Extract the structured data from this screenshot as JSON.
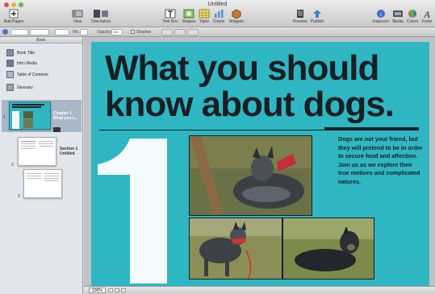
{
  "window": {
    "title": "Untitled"
  },
  "toolbar": {
    "add_pages": "Add Pages",
    "view": "View",
    "orientation": "Orientation",
    "text_box": "Text Box",
    "shapes": "Shapes",
    "table": "Table",
    "charts": "Charts",
    "widgets": "Widgets",
    "preview": "Preview",
    "publish": "Publish",
    "inspector": "Inspector",
    "media": "Media",
    "colors": "Colors",
    "fonts": "Fonts"
  },
  "formatbar": {
    "fill_label": "Fill:",
    "opacity_label": "Opacity:",
    "opacity_value": "100",
    "shadow_label": "Shadow"
  },
  "sidebar": {
    "header": "Book",
    "items": [
      {
        "label": "Book Title"
      },
      {
        "label": "Intro Media"
      },
      {
        "label": "Table of Contents"
      },
      {
        "label": "Glossary"
      }
    ],
    "thumbs": [
      {
        "num": "1",
        "caption": "Chapter 1\nWhat you s..."
      },
      {
        "num": "2",
        "caption": "Section 1\nUntitled"
      },
      {
        "num": "3",
        "caption": ""
      }
    ]
  },
  "page": {
    "title": "What you should know about dogs.",
    "big_number": "1",
    "body": "Dogs are not your friend, but they will pretend to be in order to secure food and affection. Join us as we explore their true motives and complicated natures."
  },
  "status": {
    "zoom": "100%"
  },
  "colors": {
    "page_bg": "#2fb6c3",
    "ink": "#1a1e22"
  }
}
